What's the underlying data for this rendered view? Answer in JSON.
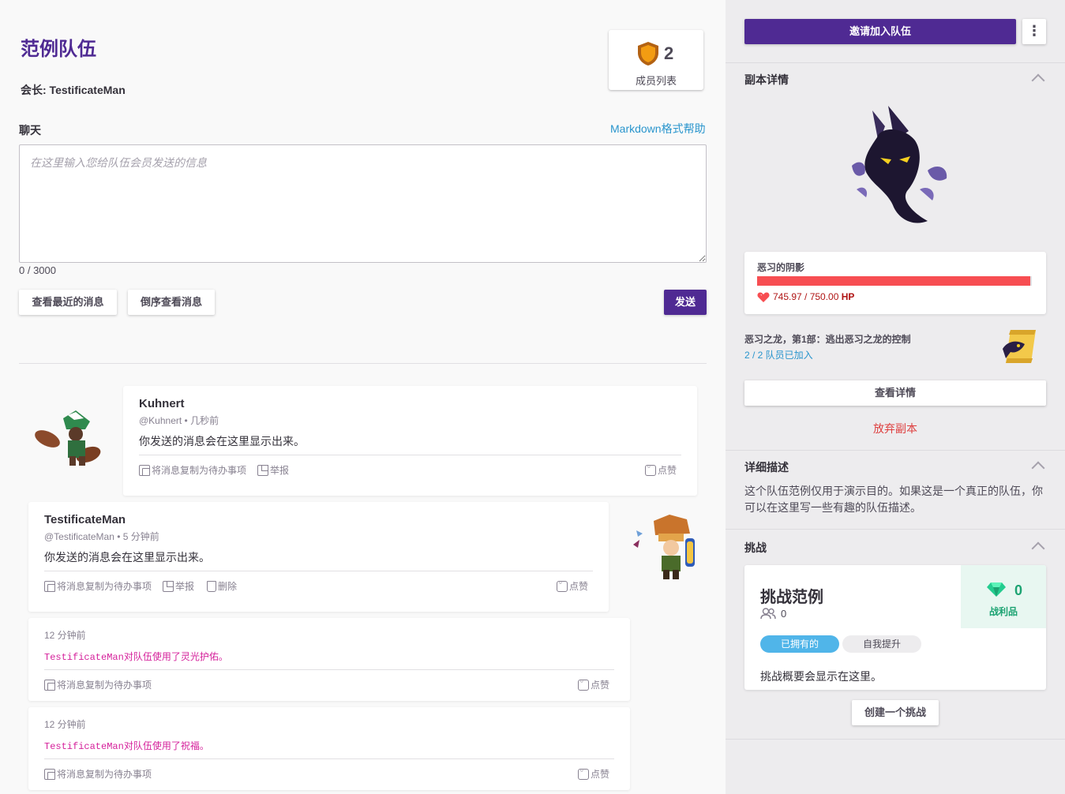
{
  "party": {
    "name": "范例队伍",
    "leader_label": "会长: TestificateMan",
    "member_count": "2",
    "member_list_label": "成员列表"
  },
  "chat": {
    "label": "聊天",
    "markdown_help": "Markdown格式帮助",
    "placeholder": "在这里输入您给队伍会员发送的信息",
    "value": "",
    "char_count": "0 / 3000",
    "btn_recent": "查看最近的消息",
    "btn_reverse": "倒序查看消息",
    "btn_send": "发送"
  },
  "messages": [
    {
      "name": "Kuhnert",
      "meta": "@Kuhnert • 几秒前",
      "text": "你发送的消息会在这里显示出来。",
      "copy": "将消息复制为待办事项",
      "report": "举报",
      "like": "点赞"
    },
    {
      "name": "TestificateMan",
      "meta": "@TestificateMan • 5 分钟前",
      "text": "你发送的消息会在这里显示出来。",
      "copy": "将消息复制为待办事项",
      "report": "举报",
      "delete": "删除",
      "like": "点赞"
    }
  ],
  "system_messages": [
    {
      "time": "12 分钟前",
      "text": "TestificateMan对队伍使用了灵光护佑。",
      "copy": "将消息复制为待办事项",
      "like": "点赞"
    },
    {
      "time": "12 分钟前",
      "text": "TestificateMan对队伍使用了祝福。",
      "copy": "将消息复制为待办事项",
      "like": "点赞"
    }
  ],
  "sidebar": {
    "invite_button": "邀请加入队伍",
    "menu_icon": "more-vertical-icon",
    "quest_section_title": "副本详情",
    "boss_name": "恶习的阴影",
    "boss_hp": "745.97 / 750.00",
    "boss_hp_unit": "HP",
    "boss_hp_fraction": 0.9946,
    "quest_name": "恶习之龙，第1部：逃出恶习之龙的控制",
    "quest_joined": "2 / 2 队员已加入",
    "view_details": "查看详情",
    "abandon_quest": "放弃副本",
    "description_title": "详细描述",
    "description_text": "这个队伍范例仅用于演示目的。如果这是一个真正的队伍，你可以在这里写一些有趣的队伍描述。",
    "challenges_title": "挑战",
    "challenge": {
      "title": "挑战范例",
      "participants": "0",
      "loot_count": "0",
      "loot_label": "战利品",
      "tag_owned": "已拥有的",
      "tag_self": "自我提升",
      "summary": "挑战概要会显示在这里。"
    },
    "create_challenge": "创建一个挑战"
  },
  "colors": {
    "brand_purple": "#4f2a93",
    "link_blue": "#2995cd",
    "hp_red": "#f74e52",
    "gem_green": "#1ca372",
    "system_pink": "#d5219b"
  }
}
